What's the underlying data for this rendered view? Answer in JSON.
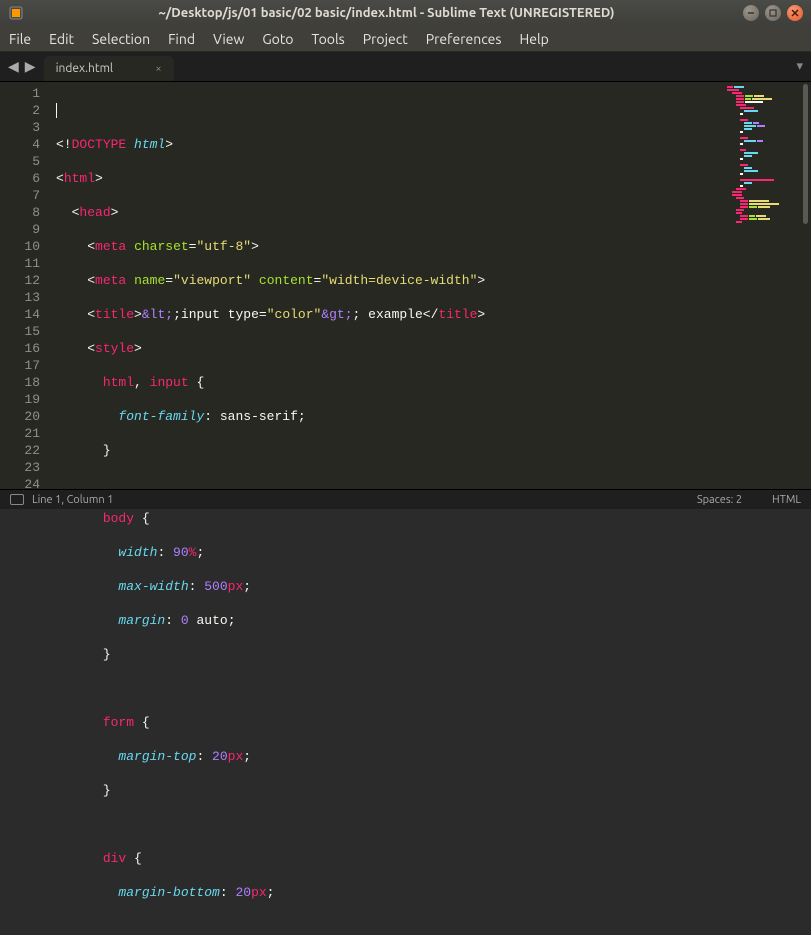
{
  "window": {
    "title": "~/Desktop/js/01 basic/02 basic/index.html - Sublime Text (UNREGISTERED)"
  },
  "menu": {
    "items": [
      "File",
      "Edit",
      "Selection",
      "Find",
      "View",
      "Goto",
      "Tools",
      "Project",
      "Preferences",
      "Help"
    ]
  },
  "tab": {
    "name": "index.html",
    "close": "×"
  },
  "gutter": {
    "lines": [
      "1",
      "2",
      "3",
      "4",
      "5",
      "6",
      "7",
      "8",
      "9",
      "10",
      "11",
      "12",
      "13",
      "14",
      "15",
      "16",
      "17",
      "18",
      "19",
      "20",
      "21",
      "22",
      "23",
      "24"
    ]
  },
  "code": {
    "l2": {
      "doctype": "DOCTYPE",
      "html": "html"
    },
    "l3": {
      "tag": "html"
    },
    "l4": {
      "tag": "head"
    },
    "l5": {
      "tag": "meta",
      "attr": "charset",
      "val": "\"utf-8\""
    },
    "l6": {
      "tag": "meta",
      "attr1": "name",
      "val1": "\"viewport\"",
      "attr2": "content",
      "val2": "\"width=device-width\""
    },
    "l7": {
      "tag": "title",
      "lt": "&lt;",
      "txt1": "input type=",
      "q": "\"color\"",
      "gt": "&gt;",
      "txt2": " example",
      "tagc": "title"
    },
    "l8": {
      "tag": "style"
    },
    "l9": {
      "sel1": "html",
      "sel2": "input"
    },
    "l10": {
      "prop": "font-family",
      "val": "sans-serif"
    },
    "l13": {
      "sel": "body"
    },
    "l14": {
      "prop": "width",
      "num": "90",
      "unit": "%"
    },
    "l15": {
      "prop": "max-width",
      "num": "500",
      "unit": "px"
    },
    "l16": {
      "prop": "margin",
      "num1": "0",
      "kw": "auto"
    },
    "l19": {
      "sel": "form"
    },
    "l20": {
      "prop": "margin-top",
      "num": "20",
      "unit": "px"
    },
    "l23": {
      "sel": "div"
    },
    "l24": {
      "prop": "margin-bottom",
      "num": "20",
      "unit": "px"
    }
  },
  "status": {
    "pos": "Line 1, Column 1",
    "spaces": "Spaces: 2",
    "lang": "HTML"
  }
}
